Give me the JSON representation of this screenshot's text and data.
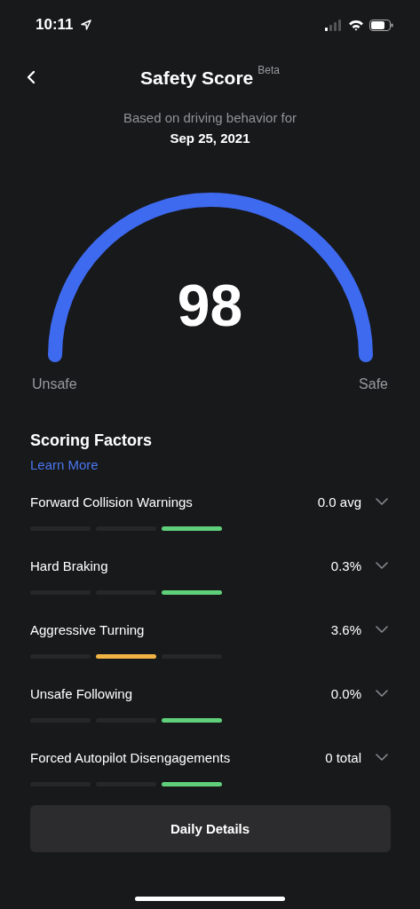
{
  "status_bar": {
    "time": "10:11"
  },
  "header": {
    "title": "Safety Score",
    "badge": "Beta"
  },
  "subtitle": "Based on driving behavior for",
  "date": "Sep 25, 2021",
  "gauge": {
    "score": "98",
    "min_label": "Unsafe",
    "max_label": "Safe"
  },
  "section": {
    "title": "Scoring Factors",
    "link": "Learn More"
  },
  "factors": [
    {
      "name": "Forward Collision Warnings",
      "value": "0.0 avg",
      "color": "#5fcf7a",
      "segments": [
        {
          "selected": false
        },
        {
          "selected": false
        },
        {
          "selected": true
        }
      ]
    },
    {
      "name": "Hard Braking",
      "value": "0.3%",
      "color": "#5fcf7a",
      "segments": [
        {
          "selected": false
        },
        {
          "selected": false
        },
        {
          "selected": true
        }
      ]
    },
    {
      "name": "Aggressive Turning",
      "value": "3.6%",
      "color": "#f0b444",
      "segments": [
        {
          "selected": false
        },
        {
          "selected": true
        },
        {
          "selected": false
        }
      ]
    },
    {
      "name": "Unsafe Following",
      "value": "0.0%",
      "color": "#5fcf7a",
      "segments": [
        {
          "selected": false
        },
        {
          "selected": false
        },
        {
          "selected": true
        }
      ]
    },
    {
      "name": "Forced Autopilot Disengagements",
      "value": "0 total",
      "color": "#5fcf7a",
      "segments": [
        {
          "selected": false
        },
        {
          "selected": false
        },
        {
          "selected": true
        }
      ]
    }
  ],
  "button": "Daily Details"
}
